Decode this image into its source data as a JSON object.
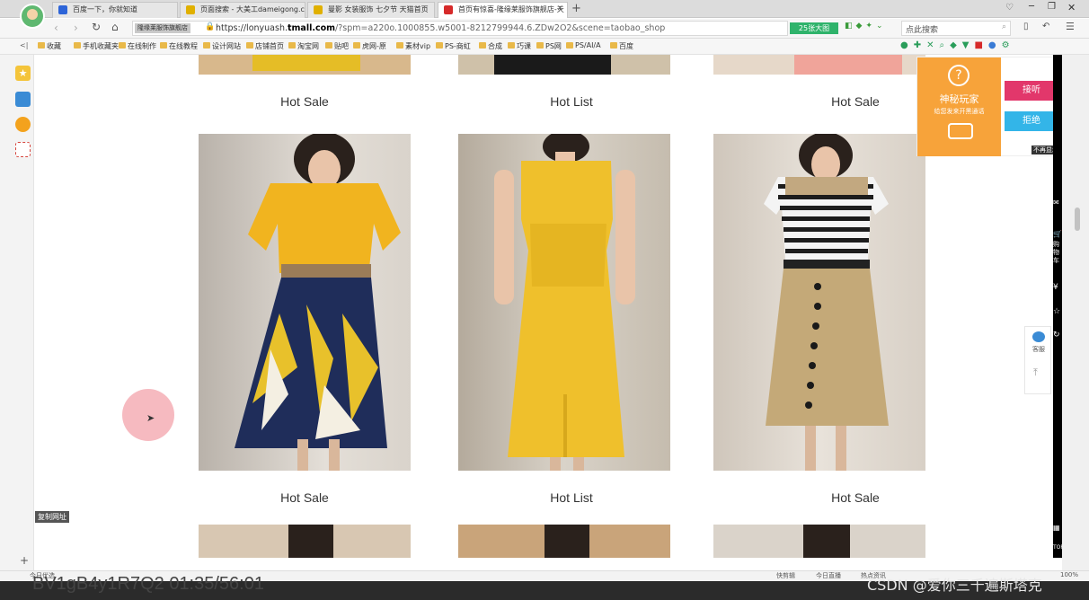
{
  "tabs": [
    {
      "label": "百度一下，你就知道",
      "color": "#2d64d8"
    },
    {
      "label": "页面搜索 - 大美工dameigong.c",
      "color": "#e0b000"
    },
    {
      "label": "曼影 女装服饰 七夕节 天猫首页",
      "color": "#e0b000"
    },
    {
      "label": "首页有惊喜-隆缘莱服饰旗舰店-天",
      "color": "#d62a2a"
    }
  ],
  "address": {
    "site_badge": "隆缘莱服饰旗舰店",
    "url_prefix": "https://lonyuash.",
    "url_domain": "tmall.com",
    "url_rest": "/?spm=a220o.1000855.w5001-8212799944.6.ZDw2O2&scene=taobao_shop",
    "promo": "25张大图",
    "search_placeholder": "点此搜索"
  },
  "bookmarks": [
    "收藏",
    "手机收藏夹",
    "在线制作",
    "在线教程",
    "设计网站",
    "店铺首页",
    "淘宝网",
    "贴吧",
    "虎网-原",
    "素材vip",
    "PS-商虹",
    "合成",
    "巧课",
    "PS网",
    "PS/AI/A",
    "百度"
  ],
  "products": {
    "row0_captions": [
      "Hot Sale",
      "Hot List",
      "Hot Sale"
    ],
    "row1_captions": [
      "Hot Sale",
      "Hot List",
      "Hot Sale"
    ]
  },
  "popup": {
    "title": "神秘玩家",
    "subtitle": "给您发来开黑通话",
    "accept": "接听",
    "reject": "拒绝",
    "dismiss": "不再显示"
  },
  "rightbar": {
    "cart": "购物车",
    "service": "客服",
    "top": "TOP"
  },
  "statusbar": {
    "left": "今日优选",
    "video1": "快剪辑",
    "video2": "今日直播",
    "video3": "热点资讯",
    "zoom": "100%"
  },
  "leftfloat": "复制网址",
  "watermark": "CSDN @爱你三千遍斯塔克",
  "video_caption": "BV1gB4y1R7Q2 01:35/56:01"
}
